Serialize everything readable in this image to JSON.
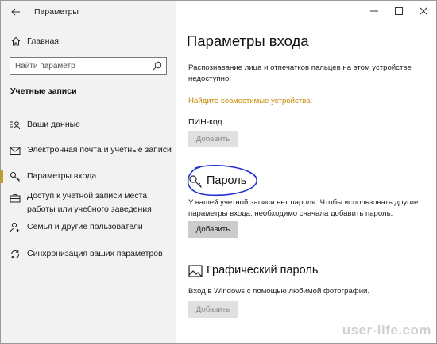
{
  "window": {
    "title": "Параметры"
  },
  "sidebar": {
    "home_label": "Главная",
    "search_placeholder": "Найти параметр",
    "section_header": "Учетные записи",
    "items": [
      {
        "label": "Ваши данные",
        "icon": "person-info-icon"
      },
      {
        "label": "Электронная почта и учетные записи",
        "icon": "mail-icon"
      },
      {
        "label": "Параметры входа",
        "icon": "key-icon",
        "active": true
      },
      {
        "label": "Доступ к учетной записи места работы или учебного заведения",
        "icon": "briefcase-icon"
      },
      {
        "label": "Семья и другие пользователи",
        "icon": "person-add-icon"
      },
      {
        "label": "Синхронизация ваших параметров",
        "icon": "sync-icon"
      }
    ]
  },
  "main": {
    "title": "Параметры входа",
    "face_text": "Распознавание лица и отпечатков пальцев на этом устройстве недоступно.",
    "compatible_link": "Найдите совместимые устройства.",
    "pin": {
      "heading": "ПИН-код",
      "button": "Добавить"
    },
    "password": {
      "heading": "Пароль",
      "text": "У вашей учетной записи нет пароля. Чтобы использовать другие параметры входа, необходимо сначала добавить пароль.",
      "button": "Добавить"
    },
    "picture_password": {
      "heading": "Графический пароль",
      "text": "Вход в Windows с помощью любимой фотографии.",
      "button": "Добавить"
    }
  },
  "watermark": "user-life.com",
  "colors": {
    "accent": "#d89b00",
    "link": "#c48a00",
    "annotation": "#1f2fd0"
  }
}
